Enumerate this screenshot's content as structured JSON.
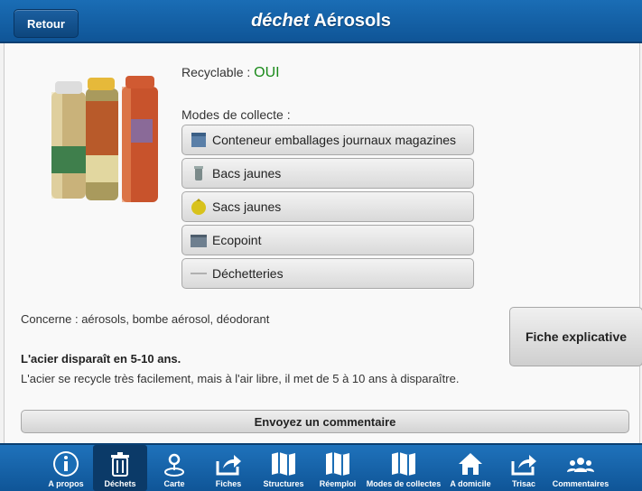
{
  "header": {
    "back_label": "Retour",
    "title_em": "déchet",
    "title_rest": " Aérosols"
  },
  "product": {
    "image_icon": "aerosol-cans-image",
    "recyclable_label": "Recyclable : ",
    "recyclable_value": "OUI",
    "modes_label": "Modes de collecte :",
    "modes": [
      {
        "label": "Conteneur emballages journaux magazines",
        "icon": "container-icon"
      },
      {
        "label": "Bacs jaunes",
        "icon": "bin-icon"
      },
      {
        "label": "Sacs jaunes",
        "icon": "bag-icon"
      },
      {
        "label": "Ecopoint",
        "icon": "ecopoint-icon"
      },
      {
        "label": "Déchetteries",
        "icon": "dechetterie-icon"
      }
    ],
    "concerne": "Concerne : aérosols, bombe aérosol, déodorant",
    "desc_title": "L'acier disparaît en 5-10 ans.",
    "desc_text": "L'acier se recycle très facilement, mais à l'air libre, il met de 5 à 10 ans à disparaître.",
    "fiche_label": "Fiche explicative",
    "comment_label": "Envoyez un commentaire"
  },
  "nav": {
    "active": "Déchets",
    "items": [
      {
        "label": "A propos",
        "icon": "info-icon"
      },
      {
        "label": "Déchets",
        "icon": "trash-icon"
      },
      {
        "label": "Carte",
        "icon": "map-pin-icon"
      },
      {
        "label": "Fiches",
        "icon": "share-icon"
      },
      {
        "label": "Structures",
        "icon": "map-icon"
      },
      {
        "label": "Réemploi",
        "icon": "map-icon"
      },
      {
        "label": "Modes de collectes",
        "icon": "map-icon"
      },
      {
        "label": "A domicile",
        "icon": "home-icon"
      },
      {
        "label": "Trisac",
        "icon": "share-icon"
      },
      {
        "label": "Commentaires",
        "icon": "users-icon"
      }
    ]
  },
  "colors": {
    "header_blue": "#1a6db5",
    "ok_green": "#1a8a1a",
    "nav_active": "#0b3a68"
  }
}
